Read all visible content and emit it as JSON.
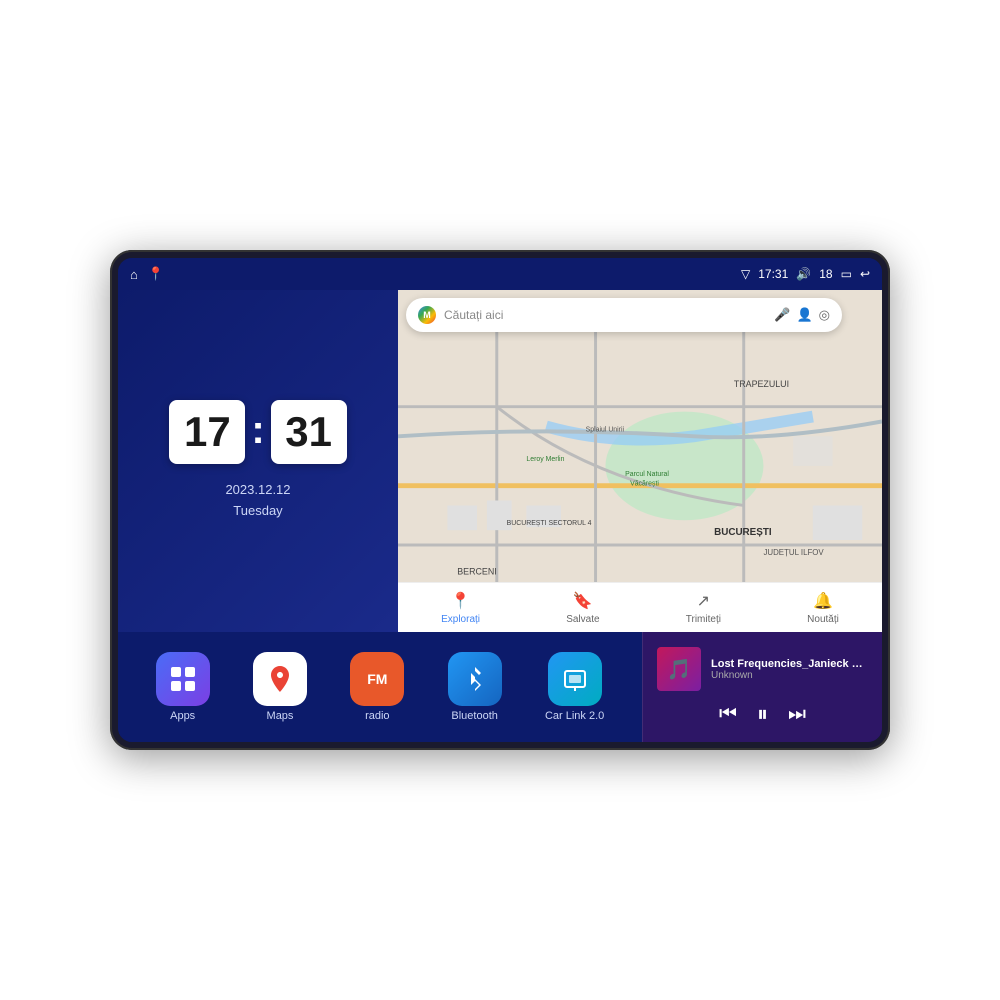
{
  "device": {
    "status_bar": {
      "signal_icon": "▽",
      "time": "17:31",
      "volume_icon": "🔊",
      "volume_level": "18",
      "battery_icon": "🔋",
      "back_icon": "↩"
    },
    "nav_left": [
      {
        "name": "home-icon",
        "symbol": "⌂"
      },
      {
        "name": "maps-pin-icon",
        "symbol": "📍"
      }
    ]
  },
  "clock": {
    "hour": "17",
    "minute": "31",
    "date": "2023.12.12",
    "day": "Tuesday"
  },
  "map": {
    "search_placeholder": "Căutați aici",
    "nav_items": [
      {
        "label": "Explorați",
        "icon": "📍",
        "active": true
      },
      {
        "label": "Salvate",
        "icon": "🔖",
        "active": false
      },
      {
        "label": "Trimiteți",
        "icon": "🔄",
        "active": false
      },
      {
        "label": "Noutăți",
        "icon": "🔔",
        "active": false
      }
    ],
    "labels": {
      "trapezului": "TRAPEZULUI",
      "bucuresti": "BUCUREȘTI",
      "judetul_ilfov": "JUDEȚUL ILFOV",
      "berceni": "BERCENI",
      "leroy": "Leroy Merlin",
      "parc": "Parcul Natural Văcărești",
      "splai": "Splaiul Unirii",
      "sector4": "BUCUREȘTI SECTORUL 4"
    }
  },
  "apps": [
    {
      "id": "apps",
      "label": "Apps",
      "icon": "⊞",
      "type": "apps-icon"
    },
    {
      "id": "maps",
      "label": "Maps",
      "icon": "M",
      "type": "maps-icon"
    },
    {
      "id": "radio",
      "label": "radio",
      "icon": "FM",
      "type": "radio-icon"
    },
    {
      "id": "bluetooth",
      "label": "Bluetooth",
      "icon": "⚡",
      "type": "bluetooth-icon"
    },
    {
      "id": "carlink",
      "label": "Car Link 2.0",
      "icon": "📱",
      "type": "carlink-icon"
    }
  ],
  "music": {
    "title": "Lost Frequencies_Janieck Devy-...",
    "artist": "Unknown",
    "controls": {
      "prev": "⏮",
      "play": "⏸",
      "next": "⏭"
    }
  }
}
